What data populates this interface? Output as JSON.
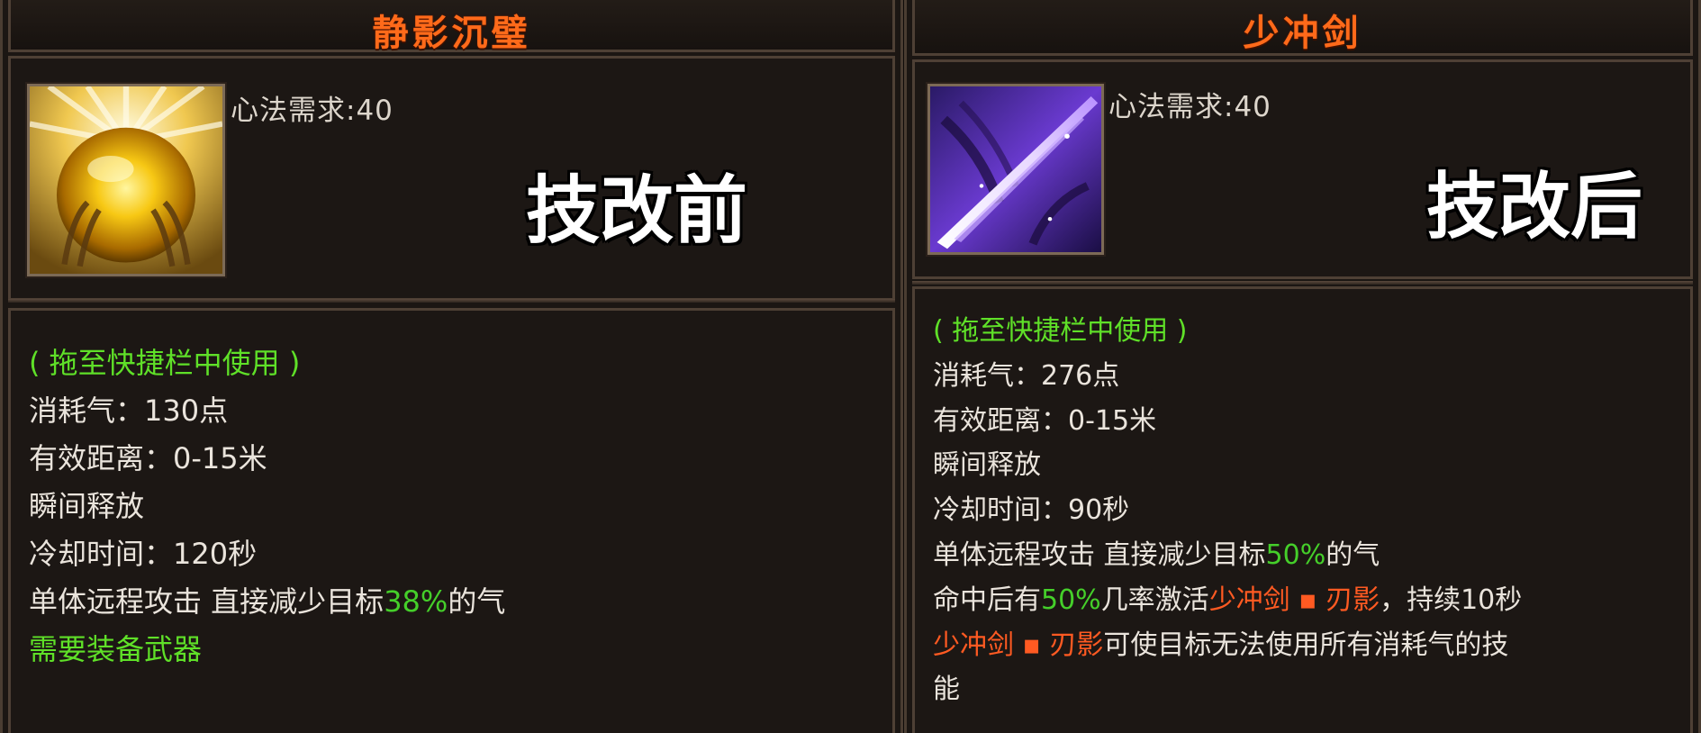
{
  "before": {
    "title": "静影沉璧",
    "requirement": "心法需求:40",
    "stamp": "技改前",
    "icon": "golden-light-orb-icon",
    "hint": "( 拖至快捷栏中使用 )",
    "cost": "消耗气：130点",
    "range": "有效距离：0-15米",
    "cast": "瞬间释放",
    "cooldown": "冷却时间：120秒",
    "effect_prefix": "单体远程攻击 直接减少目标",
    "effect_value": "38%",
    "effect_suffix": "的气",
    "weapon": "需要装备武器"
  },
  "after": {
    "title": "少冲剑",
    "requirement": "心法需求:40",
    "stamp": "技改后",
    "icon": "purple-sword-slash-icon",
    "hint": "( 拖至快捷栏中使用 )",
    "cost": "消耗气：276点",
    "range": "有效距离：0-15米",
    "cast": "瞬间释放",
    "cooldown": "冷却时间：90秒",
    "effect_prefix": "单体远程攻击 直接减少目标",
    "effect_value": "50%",
    "effect_suffix": "的气",
    "proc_prefix": "命中后有",
    "proc_chance": "50%",
    "proc_mid": "几率激活",
    "proc_buff": "少冲剑 ▪ 刃影",
    "proc_suffix": "，持续10秒",
    "buff_name": "少冲剑 ▪ 刃影",
    "buff_desc": "可使目标无法使用所有消耗气的技",
    "buff_desc_cont": "能"
  },
  "colors": {
    "title": "#ff6a1a",
    "hint_green": "#5fe028",
    "value_green": "#45cf2a",
    "buff_orange": "#ff5a22"
  }
}
